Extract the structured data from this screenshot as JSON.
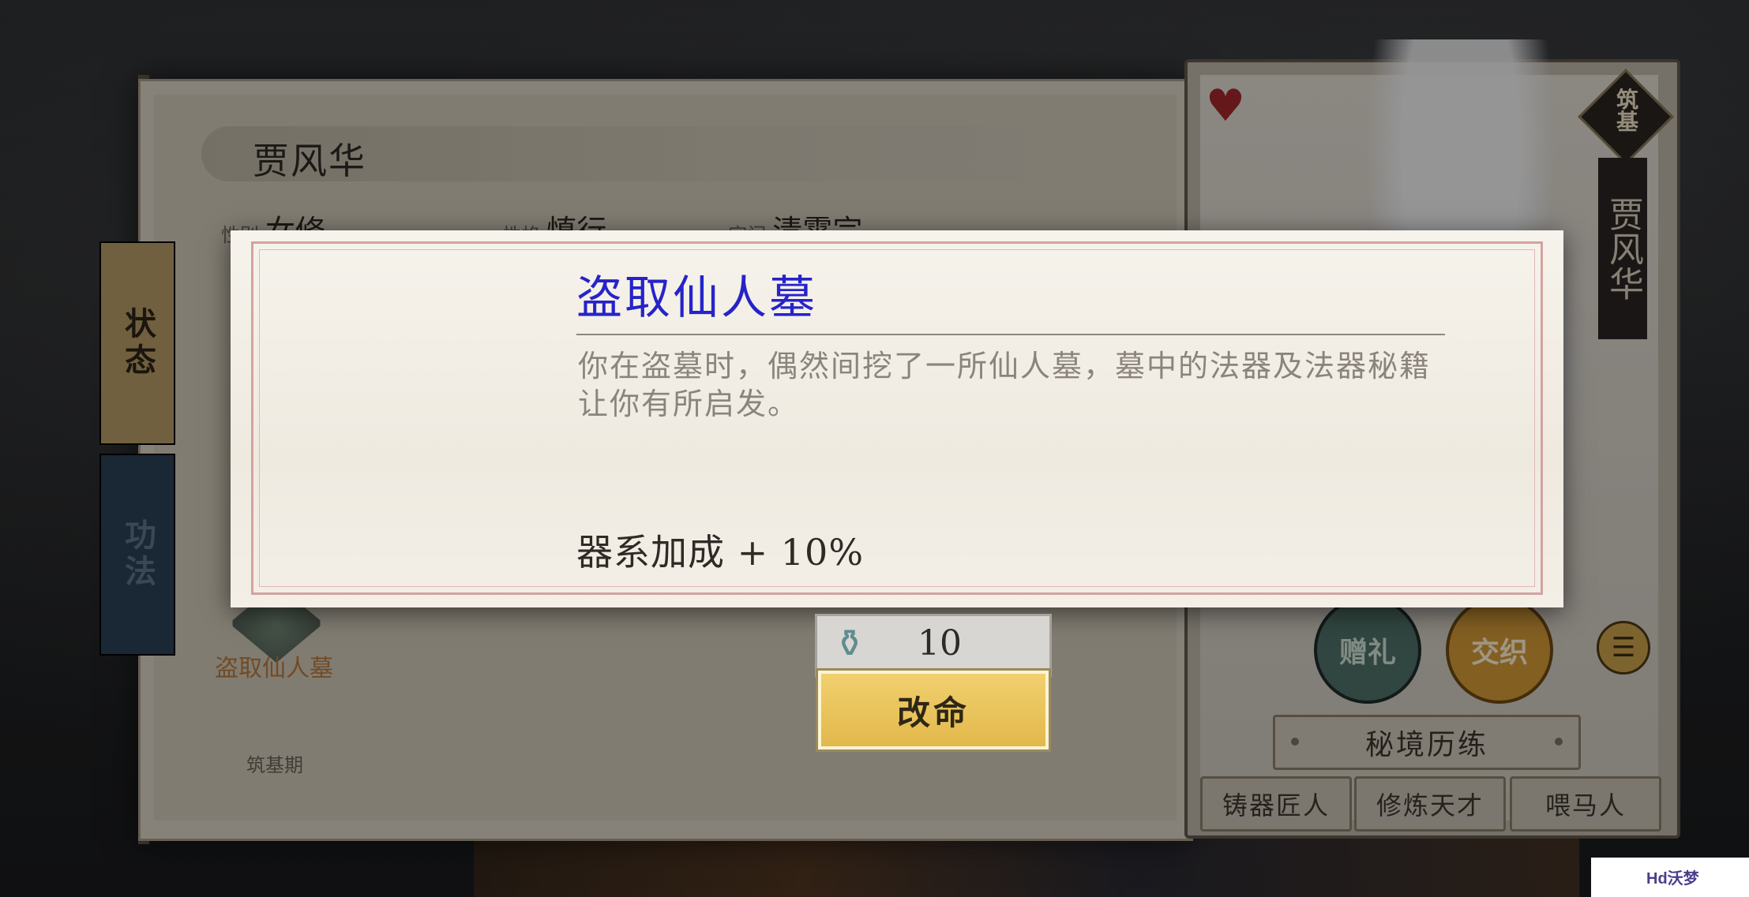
{
  "character": {
    "name": "贾风华",
    "vertical_name": "贾风华",
    "realm_badge": "筑基",
    "partial_row": [
      {
        "label": "性别",
        "value": "女修"
      },
      {
        "label": "性格",
        "value": "慎行"
      },
      {
        "label": "宗门",
        "value": "清霄宗"
      }
    ]
  },
  "tabs": [
    {
      "label": "状态",
      "active": true
    },
    {
      "label": "功法",
      "active": false
    }
  ],
  "event_card": {
    "label": "盗取仙人墓",
    "stage": "筑基期"
  },
  "dialog": {
    "title": "盗取仙人墓",
    "description": "你在盗墓时，偶然间挖了一所仙人墓，墓中的法器及法器秘籍让你有所启发。",
    "effect": "器系加成 + 10%"
  },
  "cost": {
    "icon": "potion-icon",
    "value": "10"
  },
  "reform_button": "改命",
  "character_actions": {
    "gift": "赠礼",
    "bond": "交织",
    "menu_icon": "menu-icon"
  },
  "secret_realm": "秘境历练",
  "traits": [
    "铸器匠人",
    "修炼天才",
    "喂马人"
  ],
  "watermark": "Hd沃梦",
  "colors": {
    "title_blue": "#2623c9",
    "button_gold": "#e8c25a",
    "heart_red": "#a3282a"
  }
}
